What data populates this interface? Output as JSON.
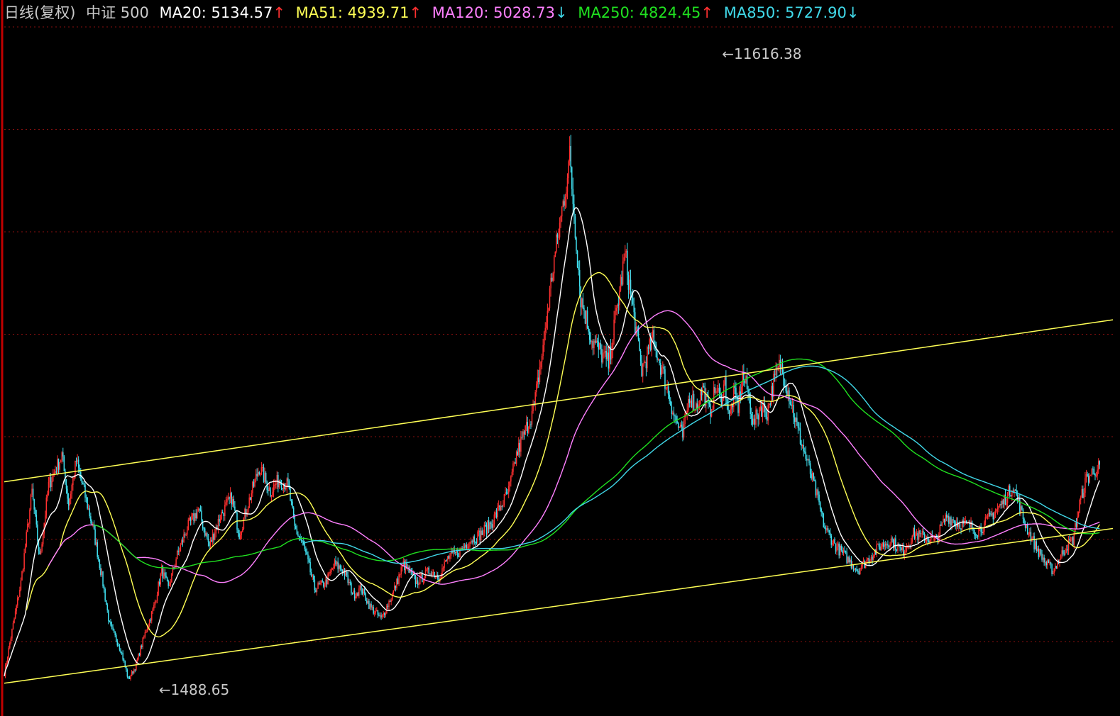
{
  "header": {
    "period": "日线(复权)",
    "index_name": "中证 500",
    "ma": [
      {
        "label": "MA20:",
        "value": "5134.57",
        "arrow": "↑",
        "arrow_color": "#ff3030",
        "color": "#ffffff"
      },
      {
        "label": "MA51:",
        "value": "4939.71",
        "arrow": "↑",
        "arrow_color": "#ff3030",
        "color": "#ffff55"
      },
      {
        "label": "MA120:",
        "value": "5028.73",
        "arrow": "↓",
        "arrow_color": "#40d8e8",
        "color": "#ff80ff"
      },
      {
        "label": "MA250:",
        "value": "4824.45",
        "arrow": "↑",
        "arrow_color": "#ff3030",
        "color": "#20e020"
      },
      {
        "label": "MA850:",
        "value": "5727.90",
        "arrow": "↓",
        "arrow_color": "#40d8e8",
        "color": "#40d8e8"
      }
    ]
  },
  "chart_data": {
    "type": "line",
    "x_unit": "trading-day index (0 = left edge, 1000 = last bar)",
    "ylim": [
      1100,
      12900
    ],
    "grid": true,
    "grid_style": "dotted dark red horizontal lines",
    "colors": {
      "up_candle": "#ff3030",
      "down_candle": "#40e0f0",
      "channel": "#ffff55",
      "grid": "#8a1010"
    },
    "annotations": [
      {
        "text": "11616.38",
        "x": 650,
        "y": 11616.38,
        "kind": "high"
      },
      {
        "text": "1488.65",
        "x": 142,
        "y": 1488.65,
        "kind": "low"
      }
    ],
    "channel_lines": [
      {
        "name": "upper",
        "x": [
          0,
          1000
        ],
        "y": [
          4960,
          7630
        ]
      },
      {
        "name": "lower",
        "x": [
          0,
          1000
        ],
        "y": [
          1640,
          4190
        ]
      }
    ],
    "price_series": {
      "name": "close",
      "x": [
        0,
        15,
        25,
        32,
        40,
        52,
        58,
        65,
        72,
        80,
        88,
        95,
        105,
        112,
        118,
        126,
        135,
        142,
        148,
        155,
        165,
        175,
        185,
        195,
        205,
        212,
        220,
        230,
        240,
        248,
        256,
        262,
        270,
        280,
        290,
        298,
        306,
        315,
        322,
        330,
        340,
        350,
        360,
        372,
        384,
        392,
        400,
        410,
        420,
        430,
        440,
        455,
        462,
        470,
        478,
        486,
        495,
        502,
        510,
        520,
        530,
        545,
        560,
        575,
        585,
        595,
        605,
        612,
        618,
        624,
        630,
        636,
        642,
        646,
        650,
        654,
        658,
        662,
        666,
        670,
        676,
        682,
        688,
        694,
        700,
        708,
        716,
        724,
        732,
        740,
        750,
        760,
        770,
        780,
        790,
        800,
        810,
        820,
        830,
        840,
        850,
        858,
        866,
        872,
        878,
        884,
        890,
        900,
        910,
        920,
        930,
        940,
        946,
        952,
        958,
        964,
        970,
        976,
        982,
        988
      ],
      "y": [
        1800,
        3300,
        4800,
        3700,
        4900,
        5400,
        4600,
        5300,
        4800,
        4200,
        3400,
        2600,
        2200,
        1700,
        1900,
        2400,
        2900,
        3500,
        3200,
        3700,
        4200,
        4500,
        3900,
        4400,
        4700,
        4100,
        4600,
        5200,
        4800,
        5000,
        4900,
        4200,
        3900,
        3200,
        3300,
        3600,
        3500,
        3100,
        3200,
        2900,
        2700,
        3100,
        3600,
        3300,
        3500,
        3400,
        3700,
        3800,
        4000,
        4100,
        4300,
        4800,
        5400,
        5800,
        6200,
        7200,
        8500,
        9300,
        10300,
        8000,
        7300,
        6900,
        8700,
        6800,
        7300,
        6700,
        6000,
        5700,
        6400,
        6200,
        6500,
        6100,
        6500,
        6300,
        6600,
        6000,
        6400,
        6200,
        6700,
        6500,
        5900,
        6200,
        6100,
        6600,
        6900,
        6400,
        5800,
        5300,
        4800,
        4200,
        3900,
        3700,
        3500,
        3700,
        3900,
        4000,
        3800,
        4100,
        4050,
        4000,
        4400,
        4300,
        4250,
        4220,
        4150,
        4250,
        4400,
        4600,
        4900,
        4300,
        3900,
        3600,
        3500,
        3700,
        3900,
        4000,
        4600,
        5000,
        5134,
        5200,
        5300,
        5134
      ]
    },
    "ma_series": [
      {
        "name": "MA20",
        "color": "#ffffff"
      },
      {
        "name": "MA51",
        "color": "#ffff55"
      },
      {
        "name": "MA120",
        "color": "#ff80ff"
      },
      {
        "name": "MA250",
        "color": "#20e020"
      },
      {
        "name": "MA850",
        "color": "#40d8e8"
      }
    ]
  }
}
